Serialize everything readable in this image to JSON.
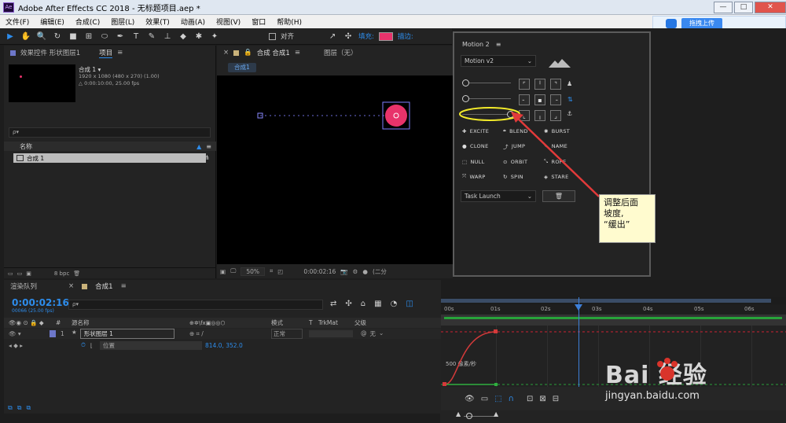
{
  "window": {
    "title": "Adobe After Effects CC 2018 - 无标题项目.aep *",
    "app_badge": "Ae",
    "min": "—",
    "max": "□",
    "close": "✕"
  },
  "menu": [
    "文件(F)",
    "编辑(E)",
    "合成(C)",
    "图层(L)",
    "效果(T)",
    "动画(A)",
    "视图(V)",
    "窗口",
    "帮助(H)"
  ],
  "toolbar": {
    "align_label": "对齐",
    "fill_label": "填充:",
    "stroke_label": "描边:",
    "fill_color": "#e8336b"
  },
  "project_panel": {
    "tab_effects": "效果控件 形状图层1",
    "tab_project": "项目",
    "comp_name": "合成 1 ▾",
    "comp_size": "1920 x 1080 (480 x 270) (1.00)",
    "comp_duration": "△ 0:00:10:00, 25.00 fps",
    "search_placeholder": "ρ▾",
    "col_name": "名称",
    "item_name": "合成 1",
    "bpc": "8 bpc"
  },
  "comp_panel": {
    "tab_comp": "合成 合成1",
    "tab_layer": "图层（无）",
    "breadcrumb": "合成1",
    "zoom": "50%",
    "timecode": "0:00:02:16",
    "resolution": "(二分"
  },
  "baidu": {
    "upload_label": "拖拽上传"
  },
  "motion": {
    "title": "Motion 2",
    "preset": "Motion v2",
    "buttons": [
      [
        "EXCITE",
        "BLEND",
        "BURST"
      ],
      [
        "CLONE",
        "JUMP",
        "NAME"
      ],
      [
        "NULL",
        "ORBIT",
        "ROPE"
      ],
      [
        "WARP",
        "SPIN",
        "STARE"
      ]
    ],
    "launch": "Task Launch",
    "trash": "🗑"
  },
  "annotation": {
    "line1": "调整后面",
    "line2": "坡度,",
    "line3": "“缓出”"
  },
  "timeline": {
    "tab_render": "渲染队列",
    "tab_comp": "合成1",
    "timecode": "0:00:02:16",
    "fps_sub": "00066 (25.00 fps)",
    "search_placeholder": "ρ▾",
    "col_source": "源名称",
    "col_mode": "模式",
    "col_t": "T",
    "col_trkmat": "TrkMat",
    "col_parent": "父级",
    "layer_index": "1",
    "layer_name": "形状图层 1",
    "layer_mode": "正常",
    "layer_parent": "无",
    "prop_name": "位置",
    "prop_value": "814.0, 352.0",
    "ruler": [
      "00s",
      "01s",
      "02s",
      "03s",
      "04s",
      "05s",
      "06s"
    ],
    "graph_label": "500 像素/秒"
  },
  "watermark": {
    "brand": "Bai  经验",
    "url": "jingyan.baidu.com"
  }
}
